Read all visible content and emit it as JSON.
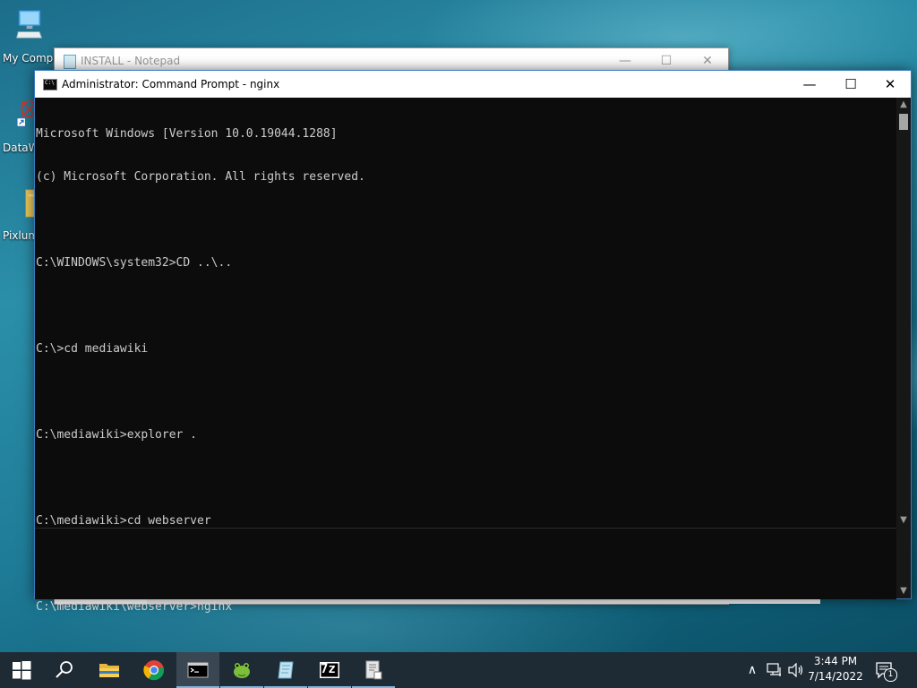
{
  "desktop": {
    "icons": [
      {
        "label": "My Compu",
        "icon": "computer-icon"
      },
      {
        "label": "DataW",
        "icon": "shortcut-app-icon"
      },
      {
        "label": "Pixlum",
        "icon": "folder-icon"
      }
    ]
  },
  "notepad": {
    "title": "INSTALL - Notepad",
    "minimize_glyph": "—",
    "maximize_glyph": "☐",
    "close_glyph": "✕"
  },
  "cmd": {
    "title": "Administrator: Command Prompt - nginx",
    "minimize_glyph": "—",
    "maximize_glyph": "☐",
    "close_glyph": "✕",
    "lines": [
      "Microsoft Windows [Version 10.0.19044.1288]",
      "(c) Microsoft Corporation. All rights reserved.",
      "",
      "C:\\WINDOWS\\system32>CD ..\\..",
      "",
      "C:\\>cd mediawiki",
      "",
      "C:\\mediawiki>explorer .",
      "",
      "C:\\mediawiki>cd webserver",
      "",
      "C:\\mediawiki\\webserver>nginx"
    ],
    "scroll_up_glyph": "▲",
    "scroll_down_glyph": "▼"
  },
  "taskbar": {
    "items": [
      {
        "name": "start-button",
        "icon": "windows-logo-icon"
      },
      {
        "name": "search-button",
        "icon": "search-icon"
      },
      {
        "name": "file-explorer",
        "icon": "folder-icon"
      },
      {
        "name": "chrome",
        "icon": "chrome-icon"
      },
      {
        "name": "command-prompt",
        "icon": "cmd-icon"
      },
      {
        "name": "notepad-plus",
        "icon": "frog-icon"
      },
      {
        "name": "notepad",
        "icon": "notepad-icon"
      },
      {
        "name": "7zip",
        "icon": "7zip-icon",
        "label": "7z"
      },
      {
        "name": "document-app",
        "icon": "document-icon"
      }
    ],
    "tray": {
      "chevron": "∧",
      "network": "network-icon",
      "volume": "volume-icon",
      "time": "3:44 PM",
      "date": "7/14/2022",
      "notifications_count": "1"
    }
  },
  "colors": {
    "console_bg": "#0c0c0c",
    "console_text": "#cccccc",
    "taskbar": "#1e2a34",
    "accent": "#7fb5e0"
  }
}
